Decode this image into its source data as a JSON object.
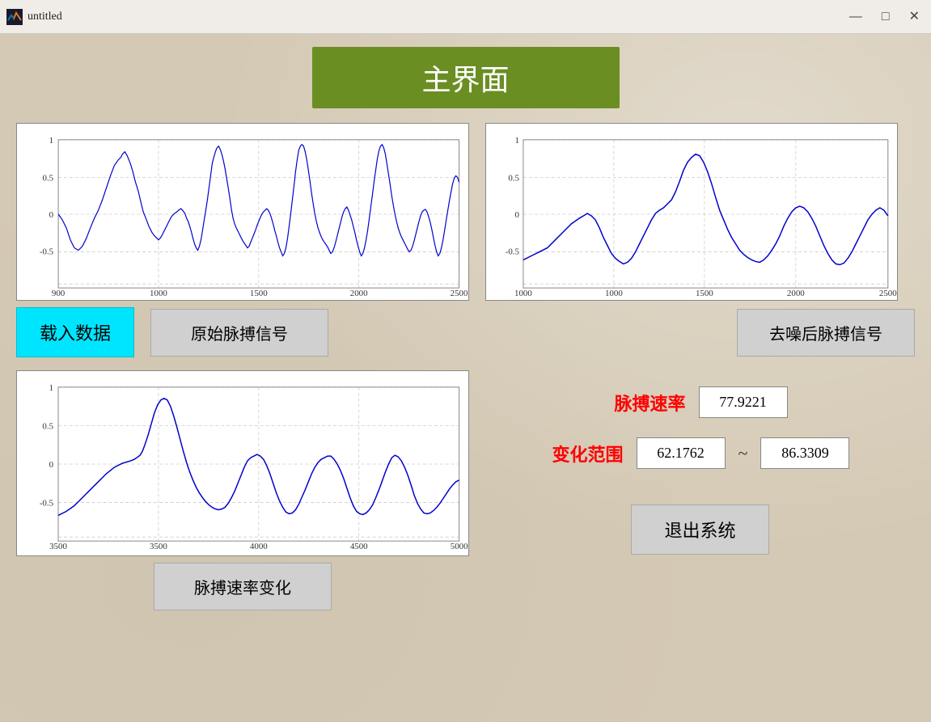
{
  "window": {
    "title": "untitled",
    "icon": "matlab-icon"
  },
  "titlebar": {
    "minimize": "—",
    "maximize": "□",
    "close": "✕"
  },
  "header": {
    "title": "主界面"
  },
  "buttons": {
    "load_data": "载入数据",
    "original_signal": "原始脉搏信号",
    "denoised_signal": "去噪后脉搏信号",
    "pulse_rate_change": "脉搏速率变化",
    "exit": "退出系统"
  },
  "metrics": {
    "pulse_rate_label": "脉搏速率",
    "pulse_rate_value": "77.9221",
    "range_label": "变化范围",
    "range_min": "62.1762",
    "range_tilde": "~",
    "range_max": "86.3309"
  },
  "charts": {
    "chart1": {
      "xmin": 900,
      "xmax": 2500,
      "ymin": -0.5,
      "ymax": 1,
      "xticks": [
        1000,
        1500,
        2000,
        2500
      ],
      "yticks": [
        1,
        0.5,
        0,
        -0.5
      ]
    },
    "chart2": {
      "xmin": 900,
      "xmax": 2500,
      "ymin": -0.5,
      "ymax": 1,
      "xticks": [
        1000,
        1500,
        2000,
        2500
      ],
      "yticks": [
        1,
        0.5,
        0,
        -0.5
      ]
    },
    "chart3": {
      "xmin": 3400,
      "xmax": 5000,
      "ymin": -0.5,
      "ymax": 1,
      "xticks": [
        3500,
        4000,
        4500,
        5000
      ],
      "yticks": [
        1,
        0.5,
        0,
        -0.5
      ]
    }
  }
}
